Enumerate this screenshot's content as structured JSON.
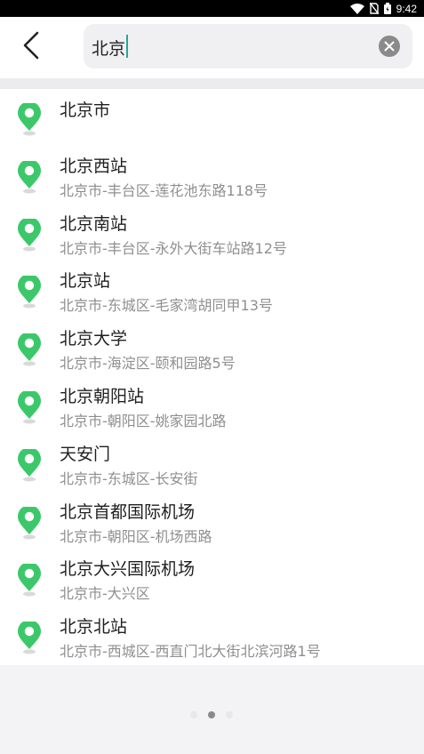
{
  "status_bar": {
    "time": "9:42",
    "icons": [
      "wifi-icon",
      "no-sim-icon",
      "battery-icon"
    ]
  },
  "search": {
    "query": "北京",
    "back_icon": "back-arrow-icon",
    "clear_icon": "clear-icon"
  },
  "colors": {
    "pin": "#3cc86a",
    "caret": "#21a89a",
    "title": "#1f1f1f",
    "subtitle": "#8f8f8f"
  },
  "results": [
    {
      "title": "北京市",
      "subtitle": ""
    },
    {
      "title": "北京西站",
      "subtitle": "北京市-丰台区-莲花池东路118号"
    },
    {
      "title": "北京南站",
      "subtitle": "北京市-丰台区-永外大街车站路12号"
    },
    {
      "title": "北京站",
      "subtitle": "北京市-东城区-毛家湾胡同甲13号"
    },
    {
      "title": "北京大学",
      "subtitle": "北京市-海淀区-颐和园路5号"
    },
    {
      "title": "北京朝阳站",
      "subtitle": "北京市-朝阳区-姚家园北路"
    },
    {
      "title": "天安门",
      "subtitle": "北京市-东城区-长安街"
    },
    {
      "title": "北京首都国际机场",
      "subtitle": "北京市-朝阳区-机场西路"
    },
    {
      "title": "北京大兴国际机场",
      "subtitle": "北京市-大兴区"
    },
    {
      "title": "北京北站",
      "subtitle": "北京市-西城区-西直门北大街北滨河路1号"
    }
  ]
}
